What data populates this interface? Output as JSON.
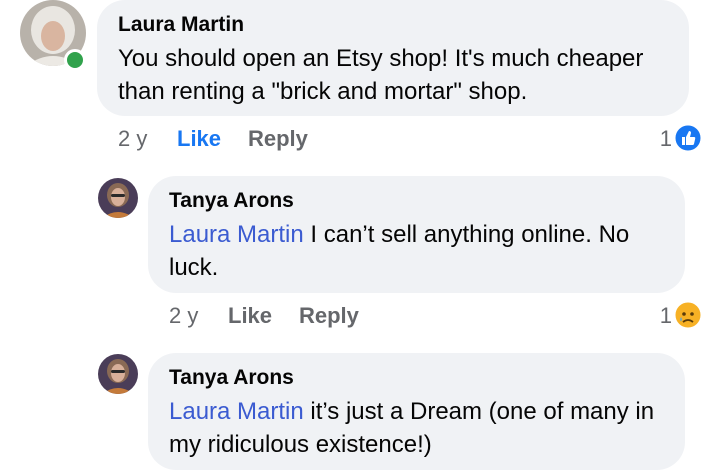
{
  "comments": [
    {
      "author": "Laura Martin",
      "mention": "",
      "text": "You should open an Etsy shop! It's much cheaper than renting a \"brick and mortar\" shop.",
      "time": "2 y",
      "like_label": "Like",
      "reply_label": "Reply",
      "reaction_count": "1",
      "reaction_icon": "like-icon",
      "online": true
    },
    {
      "author": "Tanya Arons",
      "mention": "Laura Martin",
      "text": " I can’t sell anything online. No luck.",
      "time": "2 y",
      "like_label": "Like",
      "reply_label": "Reply",
      "reaction_count": "1",
      "reaction_icon": "sad-icon"
    },
    {
      "author": "Tanya Arons",
      "mention": "Laura Martin",
      "text": " it’s just a Dream (one of many in my ridiculous existence!)"
    }
  ],
  "colors": {
    "bubble": "#f0f2f5",
    "mention": "#3b5bd1",
    "like_active": "#1877f2",
    "meta": "#65676b",
    "online": "#31a24c"
  }
}
